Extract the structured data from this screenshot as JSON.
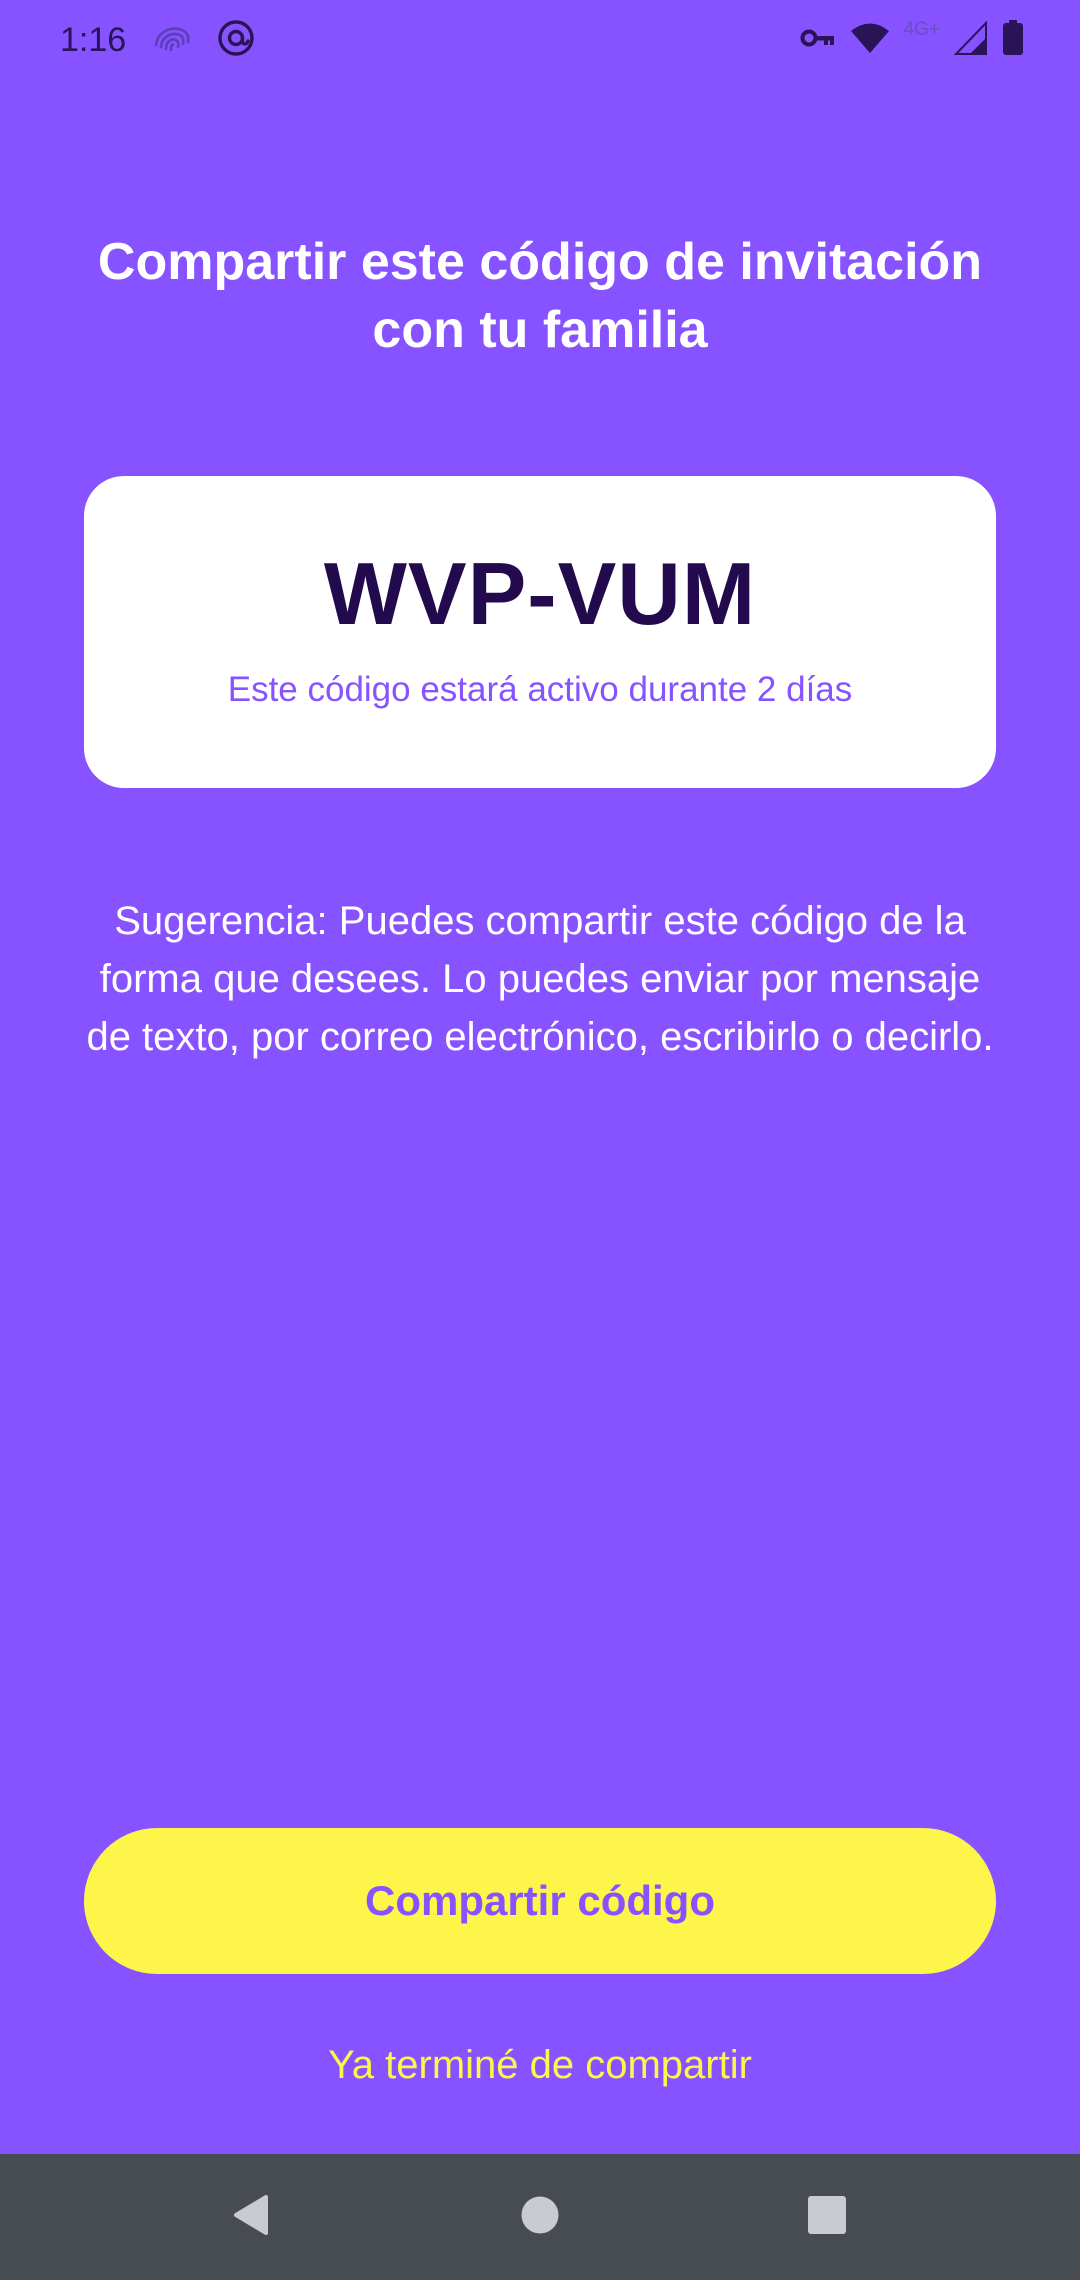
{
  "status_bar": {
    "time": "1:16",
    "network_label": "4G+",
    "left_icons": [
      "fingerprint-icon",
      "at-sign-icon"
    ],
    "right_icons": [
      "vpn-key-icon",
      "wifi-icon",
      "signal-icon",
      "battery-icon"
    ]
  },
  "title": "Compartir este código de invitación con tu familia",
  "code_card": {
    "code": "WVP-VUM",
    "note": "Este código estará activo durante 2 días"
  },
  "tip": "Sugerencia: Puedes compartir este código de la forma que desees. Lo puedes enviar por mensaje de texto, por correo electrónico, escribirlo o decirlo.",
  "actions": {
    "share_label": "Compartir código",
    "done_label": "Ya terminé de compartir"
  },
  "nav_bar": {
    "icons": [
      "back-icon",
      "home-icon",
      "recents-icon"
    ]
  },
  "colors": {
    "background": "#8752FF",
    "accent_yellow": "#FEF54A",
    "code_text": "#230a4d",
    "nav_bar": "#474B52"
  }
}
